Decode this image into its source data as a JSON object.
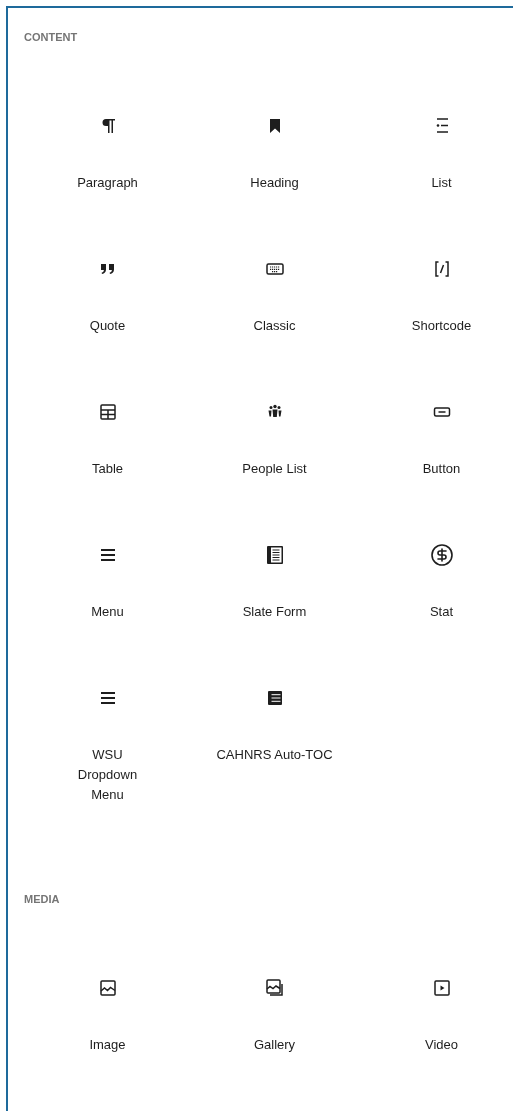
{
  "sections": [
    {
      "heading": "CONTENT",
      "items": [
        {
          "label": "Paragraph"
        },
        {
          "label": "Heading"
        },
        {
          "label": "List"
        },
        {
          "label": "Quote"
        },
        {
          "label": "Classic"
        },
        {
          "label": "Shortcode"
        },
        {
          "label": "Table"
        },
        {
          "label": "People List"
        },
        {
          "label": "Button"
        },
        {
          "label": "Menu"
        },
        {
          "label": "Slate Form"
        },
        {
          "label": "Stat"
        },
        {
          "label": "WSU\nDropdown\nMenu"
        },
        {
          "label": "CAHNRS Auto-TOC"
        }
      ]
    },
    {
      "heading": "MEDIA",
      "items": [
        {
          "label": "Image"
        },
        {
          "label": "Gallery"
        },
        {
          "label": "Video"
        }
      ]
    }
  ]
}
